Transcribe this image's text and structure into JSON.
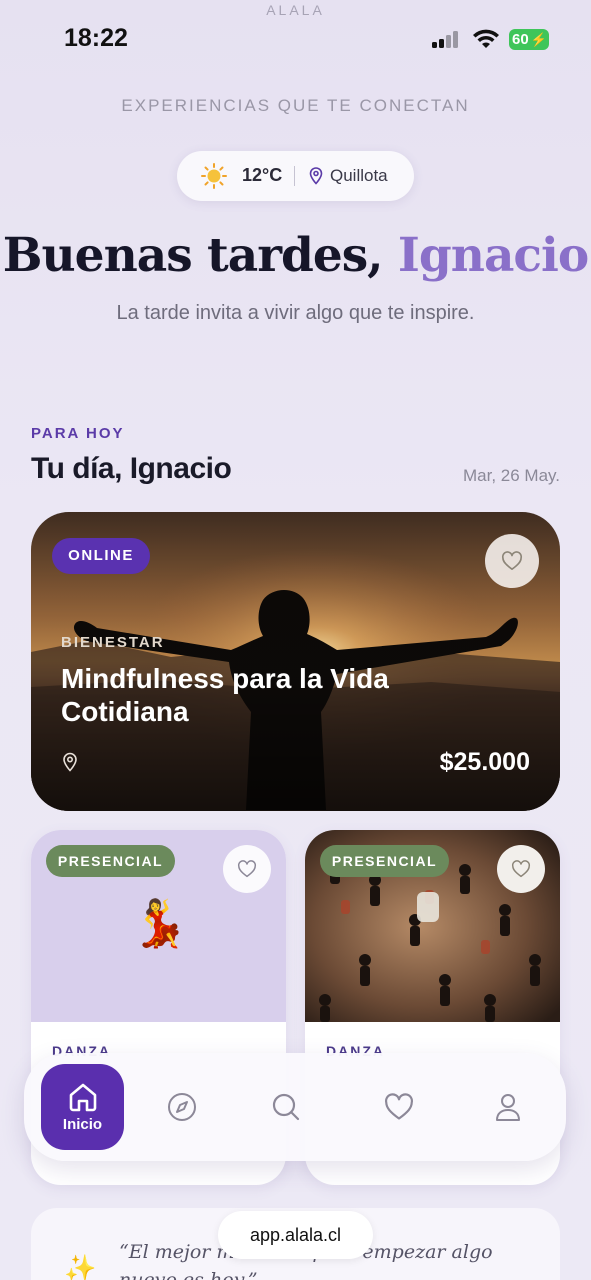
{
  "status_bar": {
    "time": "18:22",
    "battery": "60",
    "brand": "ALALA"
  },
  "header": {
    "tagline": "EXPERIENCIAS QUE TE CONECTAN",
    "weather": {
      "temperature": "12°C",
      "city": "Quillota"
    },
    "greeting_prefix": "Buenas tardes,",
    "greeting_name": "Ignacio",
    "subtitle": "La tarde invita a vivir algo que te inspire."
  },
  "today": {
    "kicker": "PARA HOY",
    "title": "Tu día, Ignacio",
    "date": "Mar, 26 May."
  },
  "featured": {
    "badge": "ONLINE",
    "category": "BIENESTAR",
    "title": "Mindfulness para la Vida Cotidiana",
    "price": "$25.000"
  },
  "cards": [
    {
      "badge": "PRESENCIAL",
      "category": "DANZA",
      "icon": "dancer-emoji",
      "emoji": "💃"
    },
    {
      "badge": "PRESENCIAL",
      "category": "DANZA",
      "icon": "dance-photo"
    }
  ],
  "quote": {
    "text": "“El mejor momento para empezar algo nuevo es hoy.”",
    "icon": "sparkles-icon"
  },
  "nav": {
    "home_label": "Inicio"
  },
  "browser": {
    "url": "app.alala.cl"
  },
  "colors": {
    "accent": "#5a2fae",
    "name_accent": "#8a70c9",
    "presencial": "#6b8a5c",
    "background": "#e9e5f3"
  }
}
